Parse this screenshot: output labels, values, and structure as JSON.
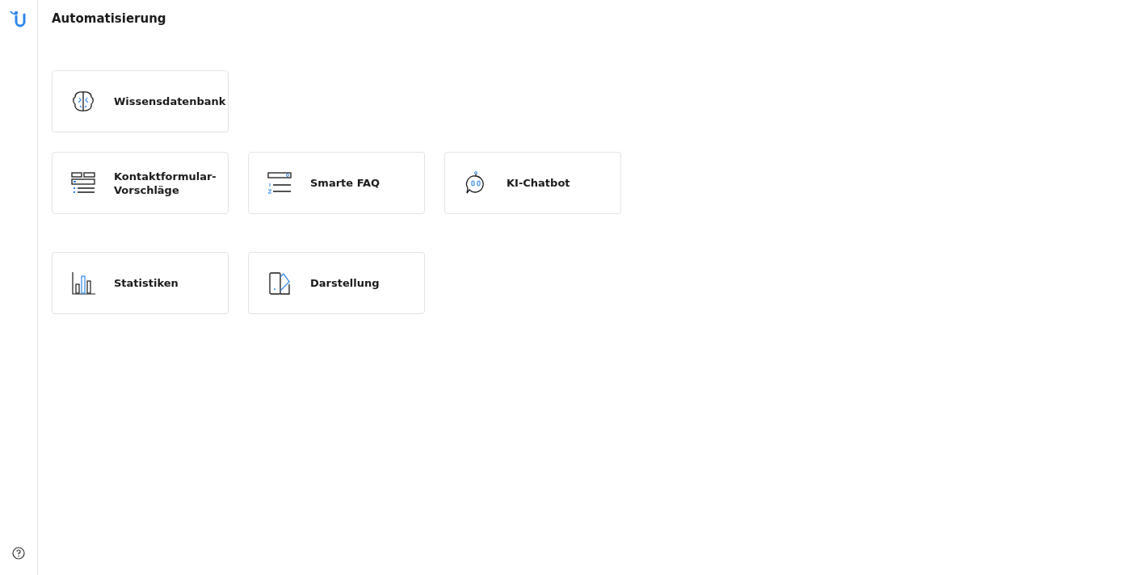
{
  "page": {
    "title": "Automatisierung"
  },
  "sections": [
    {
      "cards": [
        {
          "label": "Wissensdatenbank",
          "kind": "brain"
        }
      ]
    },
    {
      "cards": [
        {
          "label": "Kontaktformular-Vorschläge",
          "kind": "form"
        },
        {
          "label": "Smarte FAQ",
          "kind": "faq"
        },
        {
          "label": "KI-Chatbot",
          "kind": "bot"
        }
      ]
    },
    {
      "cards": [
        {
          "label": "Statistiken",
          "kind": "chart"
        },
        {
          "label": "Darstellung",
          "kind": "palette"
        }
      ]
    }
  ]
}
